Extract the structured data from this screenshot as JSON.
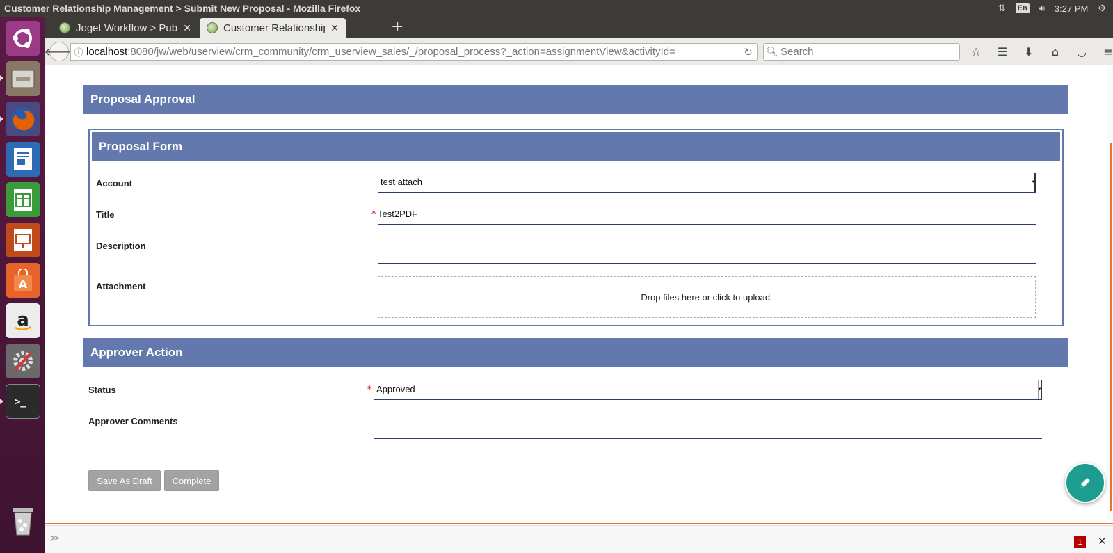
{
  "window": {
    "title": "Customer Relationship Management > Submit New Proposal - Mozilla Firefox",
    "keyboard_layout": "En",
    "clock": "3:27 PM"
  },
  "launcher": {
    "items": [
      {
        "name": "ubuntu-dash-icon",
        "color": "#9b3a86"
      },
      {
        "name": "files-icon",
        "color": "#8a7866"
      },
      {
        "name": "firefox-icon",
        "color": "#e66000"
      },
      {
        "name": "writer-icon",
        "color": "#2d6cb5"
      },
      {
        "name": "calc-icon",
        "color": "#3a9b3a"
      },
      {
        "name": "impress-icon",
        "color": "#c04a1a"
      },
      {
        "name": "software-center-icon",
        "color": "#e8622c"
      },
      {
        "name": "amazon-icon",
        "color": "#ececec"
      },
      {
        "name": "system-settings-icon",
        "color": "#6a6a6a"
      },
      {
        "name": "terminal-icon",
        "color": "#2b2b2b"
      },
      {
        "name": "trash-icon",
        "color": "#777777"
      }
    ]
  },
  "browser": {
    "tabs": [
      {
        "label": "Joget Workflow > Pub",
        "active": false
      },
      {
        "label": "Customer Relationship",
        "active": true
      }
    ],
    "new_tab": "+",
    "url_host": "localhost",
    "url_path": ":8080/jw/web/userview/crm_community/crm_userview_sales/_/proposal_process?_action=assignmentView&activityId=",
    "search_placeholder": "Search"
  },
  "page": {
    "approval_section_title": "Proposal Approval",
    "form_section_title": "Proposal Form",
    "fields": {
      "account_label": "Account",
      "account_value": "test attach",
      "title_label": "Title",
      "title_value": "Test2PDF",
      "description_label": "Description",
      "description_value": "",
      "attachment_label": "Attachment",
      "attachment_dropzone": "Drop files here or click to upload."
    },
    "approver_section_title": "Approver Action",
    "approver": {
      "status_label": "Status",
      "status_value": "Approved",
      "comments_label": "Approver Comments",
      "comments_value": ""
    },
    "required_marker": "*",
    "buttons": {
      "save_draft": "Save As Draft",
      "complete": "Complete"
    }
  },
  "devbar": {
    "error_count": "1"
  },
  "colors": {
    "section_bar": "#6379ad",
    "fab": "#1c9d8f",
    "button": "#a3a3a3"
  }
}
